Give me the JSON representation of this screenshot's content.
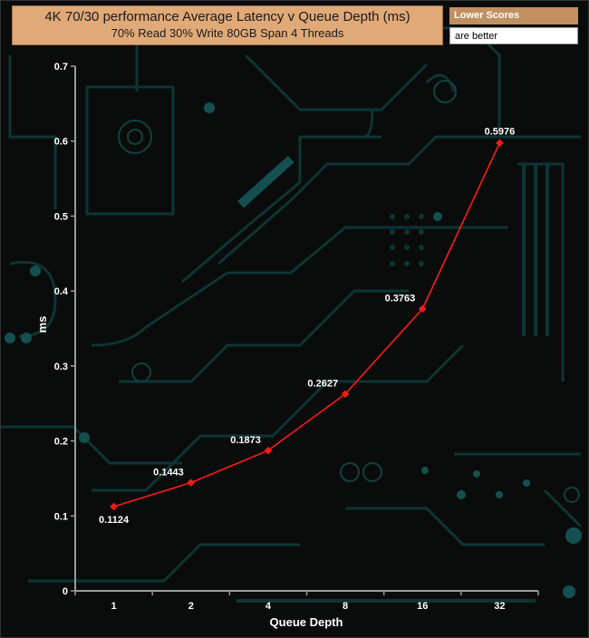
{
  "chart_data": {
    "type": "line",
    "title": "4K 70/30 performance Average Latency v Queue Depth (ms)",
    "subtitle": "70% Read 30% Write 80GB Span 4 Threads",
    "xlabel": "Queue Depth",
    "ylabel": "ms",
    "categories": [
      "1",
      "2",
      "4",
      "8",
      "16",
      "32"
    ],
    "ylim": [
      0,
      0.7
    ],
    "yticks": [
      "0",
      "0.1",
      "0.2",
      "0.3",
      "0.4",
      "0.5",
      "0.6",
      "0.7"
    ],
    "series": [
      {
        "values": [
          0.1124,
          0.1443,
          0.1873,
          0.2627,
          0.3763,
          0.5976
        ],
        "color": "#ff1a1a"
      }
    ],
    "data_labels": [
      "0.1124",
      "0.1443",
      "0.1873",
      "0.2627",
      "0.3763",
      "0.5976"
    ],
    "grid": false
  },
  "legend": {
    "heading": "Lower Scores",
    "note": "are better"
  }
}
